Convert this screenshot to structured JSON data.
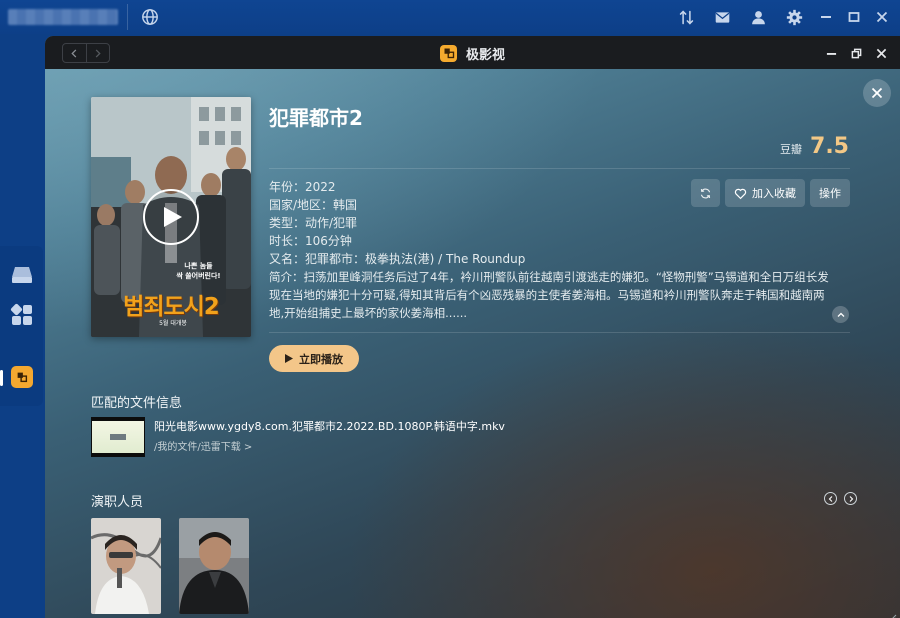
{
  "app": {
    "title": "极影视"
  },
  "movie": {
    "title": "犯罪都市2",
    "rating_label": "豆瓣",
    "rating_value": "7.5",
    "meta": {
      "year": "年份：2022",
      "region": "国家/地区：韩国",
      "genre": "类型：动作/犯罪",
      "duration": "时长：106分钟",
      "aka": "又名：犯罪都市：极拳执法(港) / The Roundup"
    },
    "synopsis": "简介：扫荡加里峰洞任务后过了4年，衿川刑警队前往越南引渡逃走的嫌犯。“怪物刑警”马锡道和全日万组长发现在当地的嫌犯十分可疑,得知其背后有个凶恶残暴的主使者姜海相。马锡道和衿川刑警队奔走于韩国和越南两地,开始组捕史上最坏的家伙姜海相......",
    "poster": {
      "tagline_line1": "나쁜 놈들",
      "tagline_line2": "싹 쓸어버린다!",
      "title_text": "범죄도시2",
      "release_text": "5월 대개봉"
    }
  },
  "actions": {
    "refresh_label": "",
    "favorite_label": "加入收藏",
    "operate_label": "操作",
    "play_label": "立即播放"
  },
  "file_section": {
    "title": "匹配的文件信息",
    "file_name": "阳光电影www.ygdy8.com.犯罪都市2.2022.BD.1080P.韩语中字.mkv",
    "file_path": "/我的文件/迅雷下载 >"
  },
  "cast_section": {
    "title": "演职人员"
  },
  "colors": {
    "accent": "#f3c689",
    "rating": "#f3c886",
    "app_logo": "#f5aa2e",
    "titlebar": "#1a1c1f",
    "os_bar": "#0d3f88"
  }
}
